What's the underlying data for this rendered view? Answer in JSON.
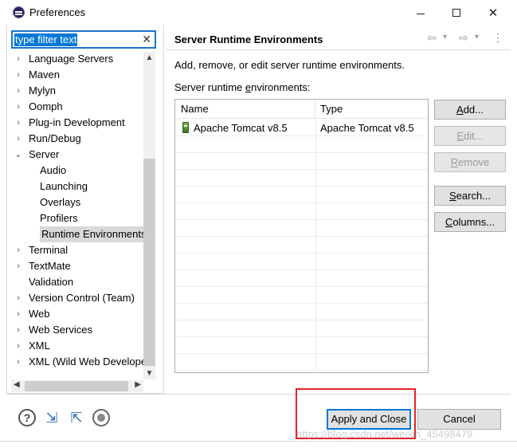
{
  "window": {
    "title": "Preferences",
    "controls": {
      "minimize": "minimize",
      "maximize": "maximize",
      "close": "✕"
    }
  },
  "filter": {
    "placeholder": "type filter text",
    "clear_symbol": "✕"
  },
  "tree": {
    "items": [
      {
        "label": "Language Servers",
        "twisty": "›",
        "level": 0
      },
      {
        "label": "Maven",
        "twisty": "›",
        "level": 0
      },
      {
        "label": "Mylyn",
        "twisty": "›",
        "level": 0
      },
      {
        "label": "Oomph",
        "twisty": "›",
        "level": 0
      },
      {
        "label": "Plug-in Development",
        "twisty": "›",
        "level": 0
      },
      {
        "label": "Run/Debug",
        "twisty": "›",
        "level": 0
      },
      {
        "label": "Server",
        "twisty": "⌄",
        "level": 0
      },
      {
        "label": "Audio",
        "twisty": "",
        "level": 1
      },
      {
        "label": "Launching",
        "twisty": "",
        "level": 1
      },
      {
        "label": "Overlays",
        "twisty": "",
        "level": 1
      },
      {
        "label": "Profilers",
        "twisty": "",
        "level": 1
      },
      {
        "label": "Runtime Environments",
        "twisty": "",
        "level": 1,
        "selected": true
      },
      {
        "label": "Terminal",
        "twisty": "›",
        "level": 0
      },
      {
        "label": "TextMate",
        "twisty": "›",
        "level": 0
      },
      {
        "label": "Validation",
        "twisty": "",
        "level": 0
      },
      {
        "label": "Version Control (Team)",
        "twisty": "›",
        "level": 0
      },
      {
        "label": "Web",
        "twisty": "›",
        "level": 0
      },
      {
        "label": "Web Services",
        "twisty": "›",
        "level": 0
      },
      {
        "label": "XML",
        "twisty": "›",
        "level": 0
      },
      {
        "label": "XML (Wild Web Developer)",
        "twisty": "›",
        "level": 0
      }
    ]
  },
  "page": {
    "title": "Server Runtime Environments",
    "nav": {
      "back": "⇦",
      "back_menu": "▾",
      "forward": "⇨",
      "forward_menu": "▾",
      "more": "⋮"
    },
    "description": "Add, remove, or edit server runtime environments.",
    "section_label_pre": "Server runtime ",
    "section_label_mnemonic": "e",
    "section_label_post": "nvironments:"
  },
  "table": {
    "columns": [
      "Name",
      "Type"
    ],
    "rows": [
      {
        "name": "Apache Tomcat v8.5",
        "type": "Apache Tomcat v8.5"
      }
    ]
  },
  "side_buttons": [
    {
      "mnemonic": "A",
      "rest": "dd...",
      "enabled": true
    },
    {
      "mnemonic": "E",
      "rest": "dit...",
      "enabled": false
    },
    {
      "mnemonic": "R",
      "rest": "emove",
      "enabled": false
    },
    {
      "mnemonic": "S",
      "rest": "earch...",
      "enabled": true
    },
    {
      "mnemonic": "C",
      "rest": "olumns...",
      "enabled": true
    }
  ],
  "footer": {
    "help": "?",
    "apply_close": "Apply and Close",
    "cancel": "Cancel",
    "watermark": "https://blog.csdn.net/weixin_45498479"
  },
  "colors": {
    "selection": "#0078d7",
    "highlight_box": "#e3242b",
    "selected_tree_row": "#d9d9d9"
  }
}
